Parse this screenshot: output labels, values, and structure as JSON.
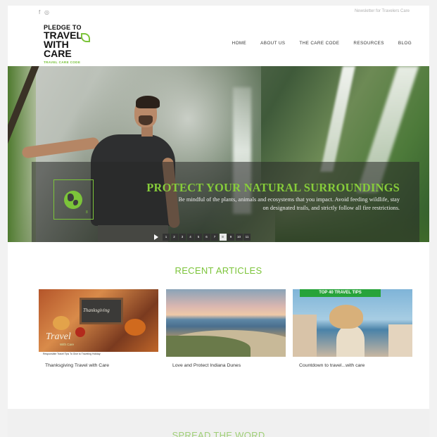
{
  "topbar": {
    "social_icons": [
      "facebook-icon",
      "instagram-icon"
    ],
    "social_glyphs": [
      "f",
      "◎"
    ],
    "link": "Newsletter for Travelers Care"
  },
  "logo": {
    "line1": "PLEDGE TO",
    "line2": "TRAVEL",
    "line3": "WITH CARE",
    "tagline": "TRAVEL CARE CODE"
  },
  "nav": {
    "items": [
      "HOME",
      "ABOUT US",
      "THE CARE CODE",
      "RESOURCES",
      "BLOG"
    ]
  },
  "hero": {
    "title": "PROTECT YOUR NATURAL SURROUNDINGS",
    "body": "Be mindful of the plants, animals and ecosystems that you impact. Avoid feeding wildlife, stay on designated trails, and strictly follow all fire restrictions.",
    "icon_small": "8",
    "pager": {
      "pages": [
        "1",
        "2",
        "3",
        "4",
        "5",
        "6",
        "7",
        "8",
        "9",
        "10",
        "11"
      ],
      "active_index": 7
    }
  },
  "recent": {
    "title": "RECENT ARTICLES",
    "articles": [
      {
        "caption": "Thanksgiving Travel with Care",
        "board_text": "Thanksgiving",
        "overlay_title": "Travel",
        "overlay_sub": "With Care",
        "strip_text": "Responsible Travel Tips To Give to Traveling Holiday"
      },
      {
        "caption": "Love and Protect Indiana Dunes"
      },
      {
        "caption": "Countdown to travel...with care",
        "banner": "TOP 40 TRAVEL TIPS"
      }
    ]
  },
  "spread": {
    "title": "SPREAD THE WORD"
  },
  "colors": {
    "accent": "#7cc43a",
    "nav_text": "#333333",
    "overlay_bg": "rgba(40,40,40,0.55)",
    "banner_green": "#27a33a"
  }
}
